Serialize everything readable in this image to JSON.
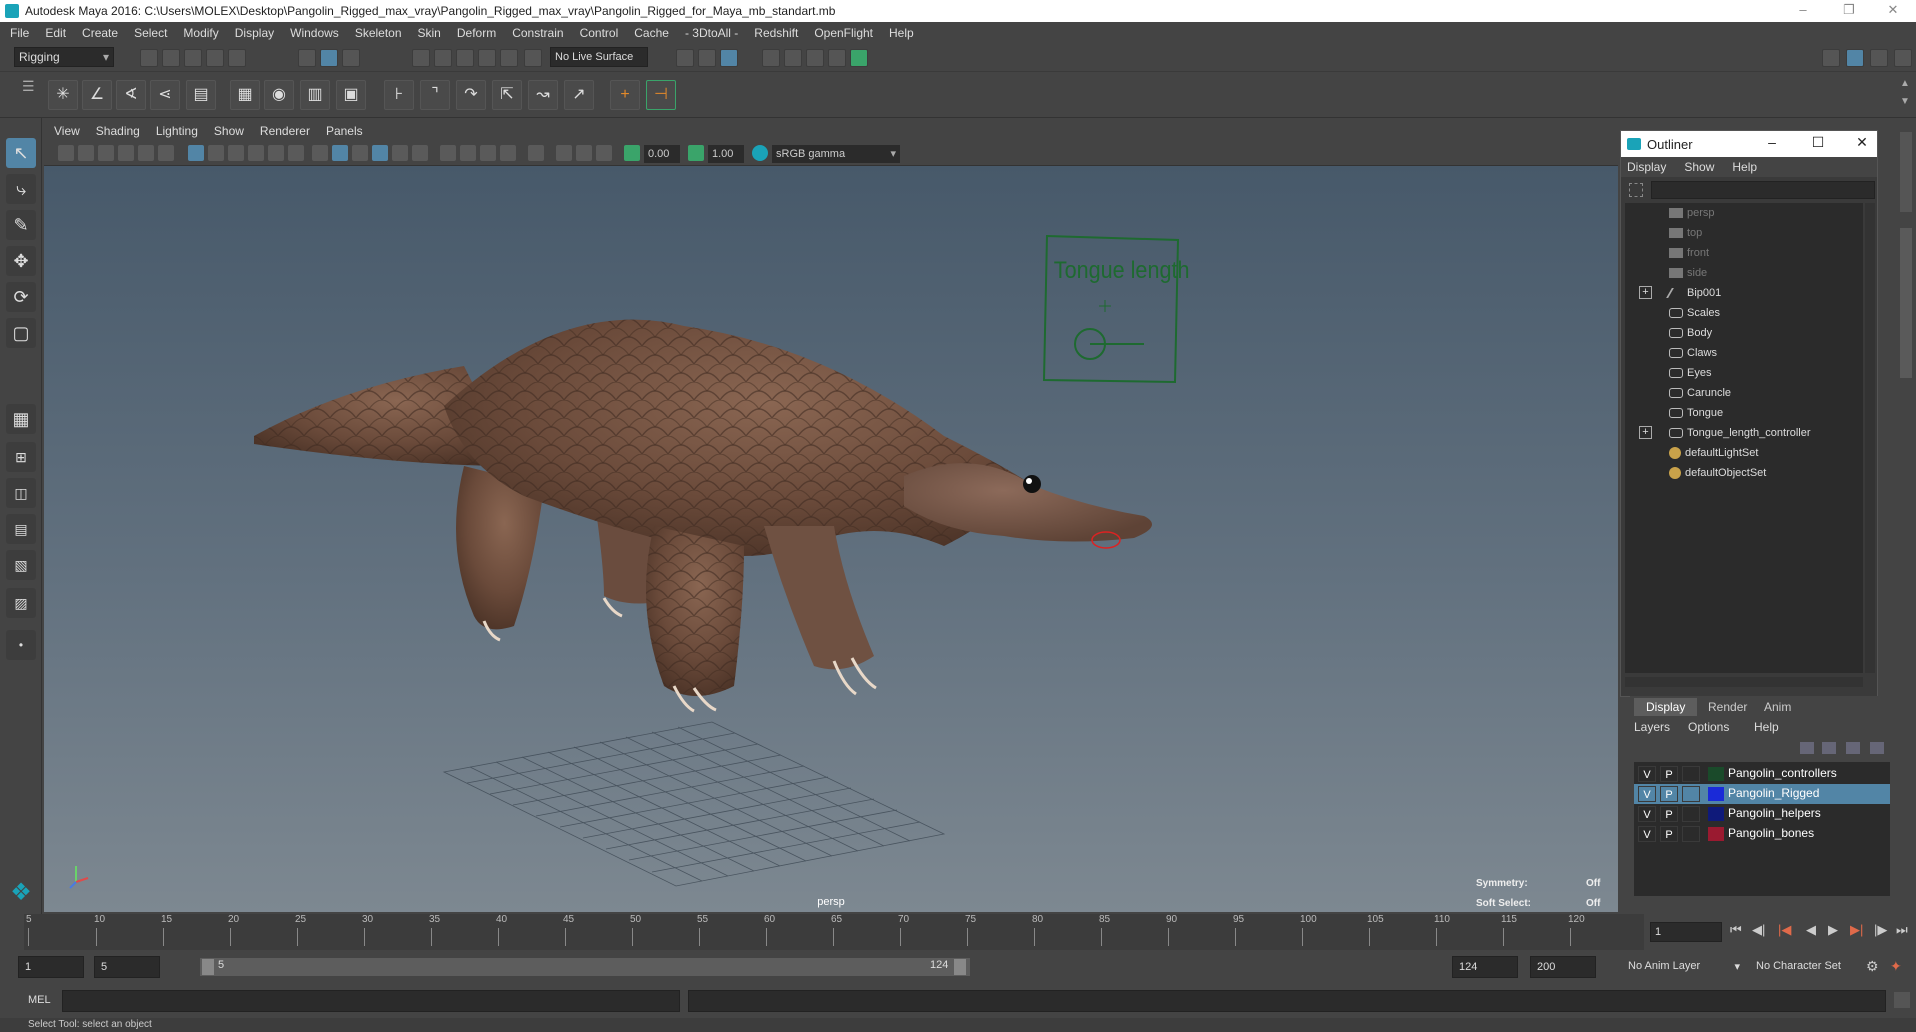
{
  "window": {
    "title": "Autodesk Maya 2016: C:\\Users\\MOLEX\\Desktop\\Pangolin_Rigged_max_vray\\Pangolin_Rigged_max_vray\\Pangolin_Rigged_for_Maya_mb_standart.mb"
  },
  "menubar": {
    "items": [
      "File",
      "Edit",
      "Create",
      "Select",
      "Modify",
      "Display",
      "Windows",
      "Skeleton",
      "Skin",
      "Deform",
      "Constrain",
      "Control",
      "Cache",
      "- 3DtoAll -",
      "Redshift",
      "OpenFlight",
      "Help"
    ]
  },
  "statusline": {
    "menuset": "Rigging",
    "live_surface": "No Live Surface"
  },
  "viewport": {
    "menu": [
      "View",
      "Shading",
      "Lighting",
      "Show",
      "Renderer",
      "Panels"
    ],
    "exposure": "0.00",
    "gamma": "1.00",
    "color_space": "sRGB gamma",
    "camera_label": "persp",
    "hud": {
      "symmetry_label": "Symmetry:",
      "symmetry_value": "Off",
      "soft_select_label": "Soft Select:",
      "soft_select_value": "Off"
    },
    "controller_text": "Tongue length"
  },
  "outliner": {
    "title": "Outliner",
    "menu": [
      "Display",
      "Show",
      "Help"
    ],
    "items": [
      {
        "label": "persp",
        "dim": true,
        "icon": "camera-icon"
      },
      {
        "label": "top",
        "dim": true,
        "icon": "camera-icon"
      },
      {
        "label": "front",
        "dim": true,
        "icon": "camera-icon"
      },
      {
        "label": "side",
        "dim": true,
        "icon": "camera-icon"
      },
      {
        "label": "Bip001",
        "expand": true,
        "icon": "joint-icon"
      },
      {
        "label": "Scales",
        "icon": "mesh-icon"
      },
      {
        "label": "Body",
        "icon": "mesh-icon"
      },
      {
        "label": "Claws",
        "icon": "mesh-icon"
      },
      {
        "label": "Eyes",
        "icon": "mesh-icon"
      },
      {
        "label": "Caruncle",
        "icon": "mesh-icon"
      },
      {
        "label": "Tongue",
        "icon": "mesh-icon"
      },
      {
        "label": "Tongue_length_controller",
        "expand": true,
        "icon": "mesh-icon"
      },
      {
        "label": "defaultLightSet",
        "icon": "set-icon"
      },
      {
        "label": "defaultObjectSet",
        "icon": "set-icon"
      }
    ]
  },
  "layer_editor": {
    "tabs": [
      "Display",
      "Render",
      "Anim"
    ],
    "menu": [
      "Layers",
      "Options",
      "Help"
    ],
    "layers": [
      {
        "v": "V",
        "p": "P",
        "name": "Pangolin_controllers",
        "color": "#1a4a2a",
        "selected": false
      },
      {
        "v": "V",
        "p": "P",
        "name": "Pangolin_Rigged",
        "color": "#1a2ad8",
        "selected": true
      },
      {
        "v": "V",
        "p": "P",
        "name": "Pangolin_helpers",
        "color": "#0f1a7a",
        "selected": false
      },
      {
        "v": "V",
        "p": "P",
        "name": "Pangolin_bones",
        "color": "#9a1a30",
        "selected": false
      }
    ]
  },
  "timeline": {
    "ticks": [
      "5",
      "10",
      "15",
      "20",
      "25",
      "30",
      "35",
      "40",
      "45",
      "50",
      "55",
      "60",
      "65",
      "70",
      "75",
      "80",
      "85",
      "90",
      "95",
      "100",
      "105",
      "110",
      "115",
      "120"
    ],
    "current_frame": "1"
  },
  "range": {
    "start": "1",
    "playback_start": "5",
    "slider_start": "5",
    "slider_end": "124",
    "playback_end": "124",
    "end": "200",
    "anim_layer": "No Anim Layer",
    "character_set": "No Character Set"
  },
  "command": {
    "lang": "MEL"
  },
  "helpline": {
    "text": "Select Tool: select an object"
  },
  "colors": {
    "accent": "#1aa3b8",
    "selection": "#5285a6",
    "controller_green": "#1e6a30"
  }
}
